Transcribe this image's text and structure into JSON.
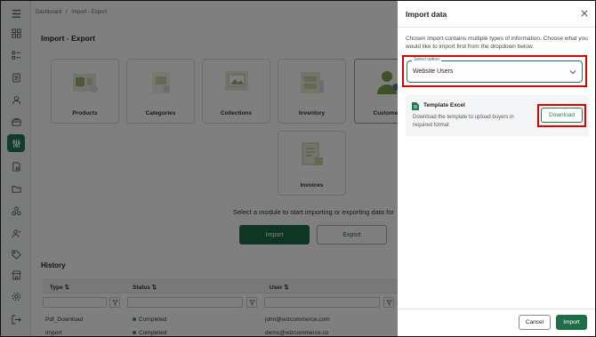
{
  "breadcrumb": {
    "home": "Dashboard",
    "separator": "/",
    "current": "Import - Export"
  },
  "page": {
    "title": "Import - Export",
    "prompt": "Select a module to start importing or exporting data for"
  },
  "modules": [
    {
      "label": "Products",
      "icon": "products-icon"
    },
    {
      "label": "Categories",
      "icon": "categories-icon"
    },
    {
      "label": "Collections",
      "icon": "collections-icon"
    },
    {
      "label": "Inventory",
      "icon": "inventory-icon"
    },
    {
      "label": "Customers",
      "icon": "customers-icon"
    },
    {
      "label": "Invoices",
      "icon": "invoices-icon"
    }
  ],
  "actions": {
    "import": "Import",
    "export": "Export"
  },
  "history": {
    "title": "History",
    "columns": [
      "Type",
      "Status",
      "User"
    ],
    "rows": [
      {
        "type": "Pdf_Download",
        "status": "Completed",
        "user": "john@wizcommerce.com"
      },
      {
        "type": "Import",
        "status": "Completed",
        "user": "demo@wizcommerce.co"
      }
    ]
  },
  "drawer": {
    "title": "Import data",
    "description": "Chosen import contains multiple types of information. Choose what you would like to import first from the dropdown below.",
    "select": {
      "legend": "Select option",
      "value": "Website Users"
    },
    "template": {
      "title": "Template Excel",
      "description": "Download the template to upload buyers in required format",
      "download_label": "Download"
    },
    "cancel_label": "Cancel",
    "import_label": "Import"
  },
  "colors": {
    "primary": "#1d6e47",
    "highlight": "#e00000"
  }
}
